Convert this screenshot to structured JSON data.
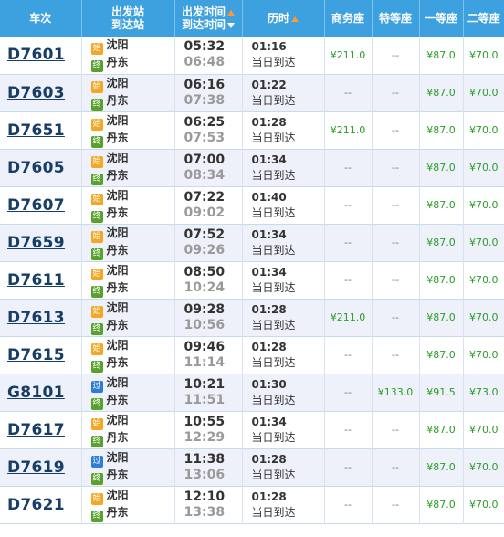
{
  "headers": {
    "train": "车次",
    "station_dep": "出发站",
    "station_arr": "到达站",
    "time_dep": "出发时间",
    "time_arr": "到达时间",
    "duration": "历时",
    "business": "商务座",
    "premium": "特等座",
    "first": "一等座",
    "second": "二等座"
  },
  "badge_labels": {
    "start": "始",
    "end": "终",
    "pass": "过"
  },
  "colors": {
    "header_bg": "#3da1e0",
    "price_green": "#2a9d2a",
    "badge_start": "#f5a623",
    "badge_end": "#58a12b",
    "badge_pass": "#2d7cd6"
  },
  "rows": [
    {
      "train": "D7601",
      "dep_type": "start",
      "dep_label": "始",
      "dep_station": "沈阳",
      "arr_type": "end",
      "arr_label": "终",
      "arr_station": "丹东",
      "dep_time": "05:32",
      "arr_time": "06:48",
      "duration": "01:16",
      "arrival_note": "当日到达",
      "business": "¥211.0",
      "premium": "--",
      "first": "¥87.0",
      "second": "¥70.0"
    },
    {
      "train": "D7603",
      "dep_type": "start",
      "dep_label": "始",
      "dep_station": "沈阳",
      "arr_type": "end",
      "arr_label": "终",
      "arr_station": "丹东",
      "dep_time": "06:16",
      "arr_time": "07:38",
      "duration": "01:22",
      "arrival_note": "当日到达",
      "business": "--",
      "premium": "--",
      "first": "¥87.0",
      "second": "¥70.0"
    },
    {
      "train": "D7651",
      "dep_type": "start",
      "dep_label": "始",
      "dep_station": "沈阳",
      "arr_type": "end",
      "arr_label": "终",
      "arr_station": "丹东",
      "dep_time": "06:25",
      "arr_time": "07:53",
      "duration": "01:28",
      "arrival_note": "当日到达",
      "business": "¥211.0",
      "premium": "--",
      "first": "¥87.0",
      "second": "¥70.0"
    },
    {
      "train": "D7605",
      "dep_type": "start",
      "dep_label": "始",
      "dep_station": "沈阳",
      "arr_type": "end",
      "arr_label": "终",
      "arr_station": "丹东",
      "dep_time": "07:00",
      "arr_time": "08:34",
      "duration": "01:34",
      "arrival_note": "当日到达",
      "business": "--",
      "premium": "--",
      "first": "¥87.0",
      "second": "¥70.0"
    },
    {
      "train": "D7607",
      "dep_type": "start",
      "dep_label": "始",
      "dep_station": "沈阳",
      "arr_type": "end",
      "arr_label": "终",
      "arr_station": "丹东",
      "dep_time": "07:22",
      "arr_time": "09:02",
      "duration": "01:40",
      "arrival_note": "当日到达",
      "business": "--",
      "premium": "--",
      "first": "¥87.0",
      "second": "¥70.0"
    },
    {
      "train": "D7659",
      "dep_type": "start",
      "dep_label": "始",
      "dep_station": "沈阳",
      "arr_type": "end",
      "arr_label": "终",
      "arr_station": "丹东",
      "dep_time": "07:52",
      "arr_time": "09:26",
      "duration": "01:34",
      "arrival_note": "当日到达",
      "business": "--",
      "premium": "--",
      "first": "¥87.0",
      "second": "¥70.0"
    },
    {
      "train": "D7611",
      "dep_type": "start",
      "dep_label": "始",
      "dep_station": "沈阳",
      "arr_type": "end",
      "arr_label": "终",
      "arr_station": "丹东",
      "dep_time": "08:50",
      "arr_time": "10:24",
      "duration": "01:34",
      "arrival_note": "当日到达",
      "business": "--",
      "premium": "--",
      "first": "¥87.0",
      "second": "¥70.0"
    },
    {
      "train": "D7613",
      "dep_type": "start",
      "dep_label": "始",
      "dep_station": "沈阳",
      "arr_type": "end",
      "arr_label": "终",
      "arr_station": "丹东",
      "dep_time": "09:28",
      "arr_time": "10:56",
      "duration": "01:28",
      "arrival_note": "当日到达",
      "business": "¥211.0",
      "premium": "--",
      "first": "¥87.0",
      "second": "¥70.0"
    },
    {
      "train": "D7615",
      "dep_type": "start",
      "dep_label": "始",
      "dep_station": "沈阳",
      "arr_type": "end",
      "arr_label": "终",
      "arr_station": "丹东",
      "dep_time": "09:46",
      "arr_time": "11:14",
      "duration": "01:28",
      "arrival_note": "当日到达",
      "business": "--",
      "premium": "--",
      "first": "¥87.0",
      "second": "¥70.0"
    },
    {
      "train": "G8101",
      "dep_type": "pass",
      "dep_label": "过",
      "dep_station": "沈阳",
      "arr_type": "end",
      "arr_label": "终",
      "arr_station": "丹东",
      "dep_time": "10:21",
      "arr_time": "11:51",
      "duration": "01:30",
      "arrival_note": "当日到达",
      "business": "--",
      "premium": "¥133.0",
      "first": "¥91.5",
      "second": "¥73.0"
    },
    {
      "train": "D7617",
      "dep_type": "start",
      "dep_label": "始",
      "dep_station": "沈阳",
      "arr_type": "end",
      "arr_label": "终",
      "arr_station": "丹东",
      "dep_time": "10:55",
      "arr_time": "12:29",
      "duration": "01:34",
      "arrival_note": "当日到达",
      "business": "--",
      "premium": "--",
      "first": "¥87.0",
      "second": "¥70.0"
    },
    {
      "train": "D7619",
      "dep_type": "pass",
      "dep_label": "过",
      "dep_station": "沈阳",
      "arr_type": "end",
      "arr_label": "终",
      "arr_station": "丹东",
      "dep_time": "11:38",
      "arr_time": "13:06",
      "duration": "01:28",
      "arrival_note": "当日到达",
      "business": "--",
      "premium": "--",
      "first": "¥87.0",
      "second": "¥70.0"
    },
    {
      "train": "D7621",
      "dep_type": "start",
      "dep_label": "始",
      "dep_station": "沈阳",
      "arr_type": "end",
      "arr_label": "终",
      "arr_station": "丹东",
      "dep_time": "12:10",
      "arr_time": "13:38",
      "duration": "01:28",
      "arrival_note": "当日到达",
      "business": "--",
      "premium": "--",
      "first": "¥87.0",
      "second": "¥70.0"
    }
  ]
}
